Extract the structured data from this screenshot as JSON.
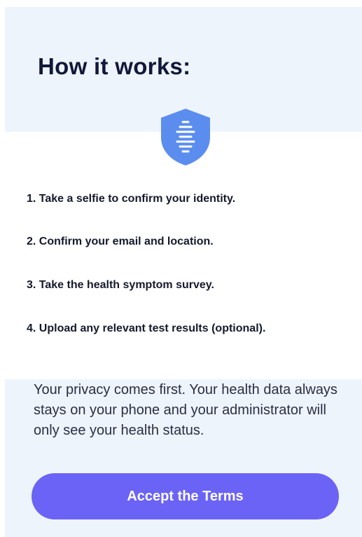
{
  "header": {
    "title": "How it works:"
  },
  "icon": {
    "name": "shield-soundwave-icon",
    "color": "#5b8def"
  },
  "steps": [
    "1. Take a selfie to confirm your identity.",
    "2. Confirm your email and location.",
    "3. Take the health symptom survey.",
    "4. Upload any relevant test results (optional)."
  ],
  "privacy_text": "Your privacy comes first. Your health data always stays on your phone and your administrator will only see your health status.",
  "accept_button": {
    "label": "Accept the Terms",
    "color": "#6b63f5"
  }
}
